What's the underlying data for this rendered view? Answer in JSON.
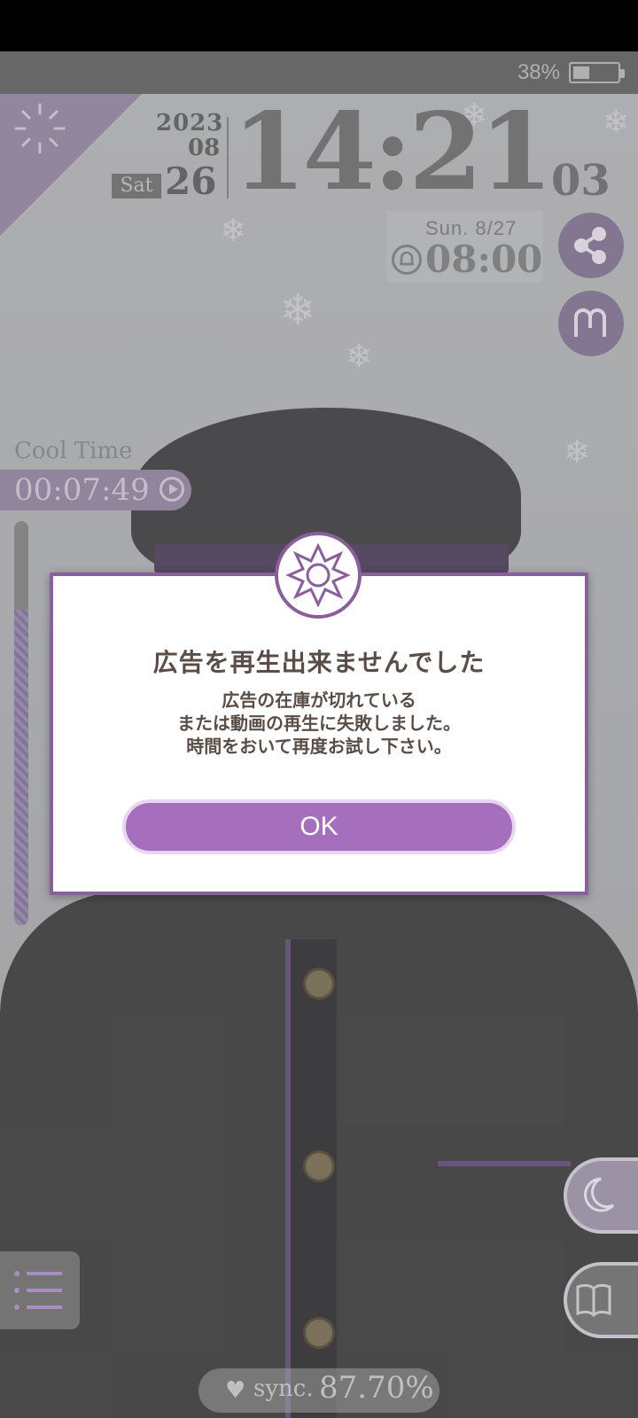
{
  "status_bar": {
    "battery_percent": "38%",
    "battery_level": 0.38
  },
  "clock": {
    "year": "2023",
    "month": "08",
    "day_of_week": "Sat",
    "day": "26",
    "time": "14:21",
    "seconds": "03"
  },
  "alarm": {
    "date": "Sun. 8/27",
    "time": "08:00"
  },
  "cool_time": {
    "label": "Cool Time",
    "value": "00:07:49",
    "gauge_level": 0.78
  },
  "dialog": {
    "title": "広告を再生出来ませんでした",
    "message_lines": [
      "広告の在庫が切れている",
      "または動画の再生に失敗しました。",
      "時間をおいて再度お試し下さい。"
    ],
    "ok_label": "OK"
  },
  "sync": {
    "label": "sync.",
    "value": "87.70%"
  },
  "colors": {
    "accent_purple": "#a66fbe",
    "border_purple": "#86619a",
    "text_brown": "#5a4d45"
  },
  "icons": {
    "share": "share-icon",
    "map": "map-icon",
    "moon": "moon-icon",
    "book": "book-icon",
    "menu": "menu-icon",
    "bell": "bell-icon",
    "heart": "heart-icon",
    "play": "play-icon",
    "logo": "flower-logo-icon"
  }
}
